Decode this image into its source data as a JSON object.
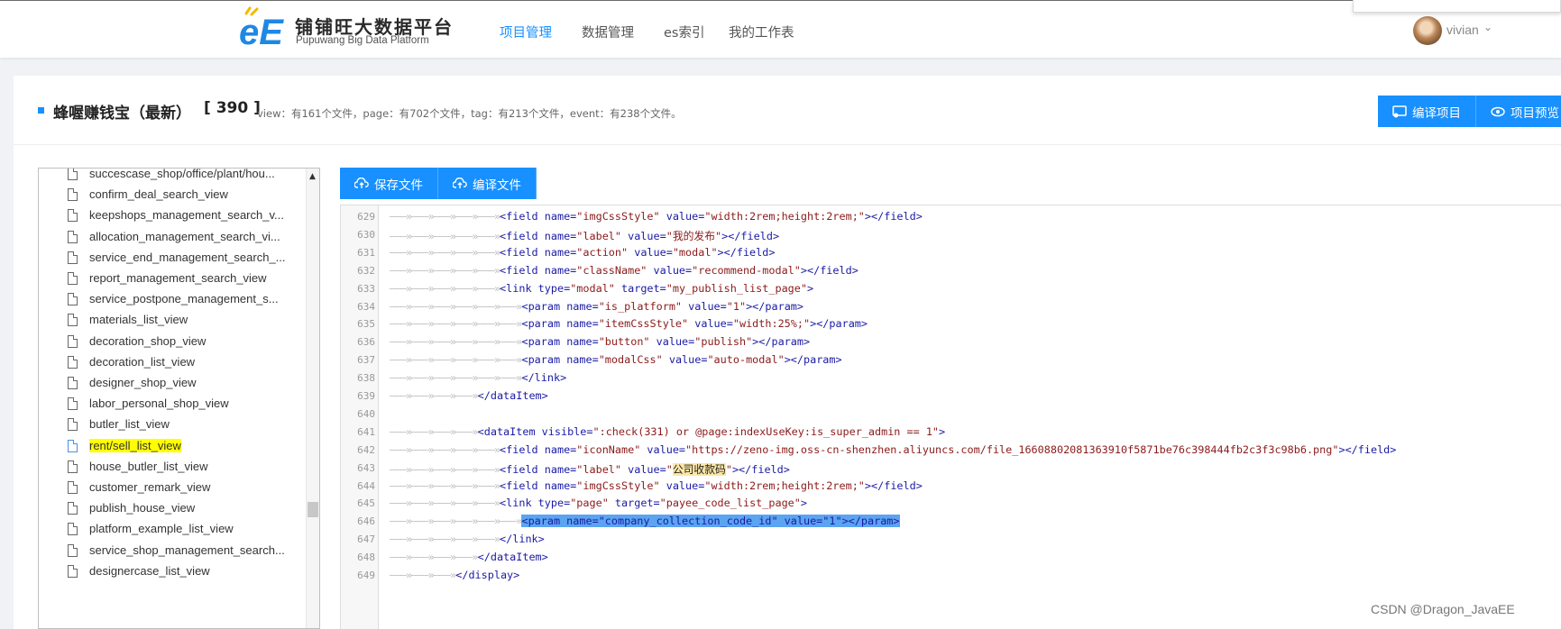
{
  "brand": {
    "title": "铺铺旺大数据平台",
    "subtitle": "Pupuwang Big Data Platform"
  },
  "nav": [
    {
      "label": "项目管理",
      "active": true
    },
    {
      "label": "数据管理",
      "active": false
    },
    {
      "label": "es索引",
      "active": false
    },
    {
      "label": "我的工作表",
      "active": false
    }
  ],
  "user": {
    "name": "vivian"
  },
  "project": {
    "title": "蜂喔赚钱宝（最新）",
    "count": "[ 390 ]",
    "stats": "view：有161个文件，page：有702个文件，tag：有213个文件，event：有238个文件。"
  },
  "actions": {
    "compile_project": "编译项目",
    "preview_project": "项目预览"
  },
  "editor_actions": {
    "save_file": "保存文件",
    "compile_file": "编译文件"
  },
  "tree": {
    "items": [
      {
        "label": "succescase_shop/office/plant/hou...",
        "selected": false
      },
      {
        "label": "confirm_deal_search_view",
        "selected": false
      },
      {
        "label": "keepshops_management_search_v...",
        "selected": false
      },
      {
        "label": "allocation_management_search_vi...",
        "selected": false
      },
      {
        "label": "service_end_management_search_...",
        "selected": false
      },
      {
        "label": "report_management_search_view",
        "selected": false
      },
      {
        "label": "service_postpone_management_s...",
        "selected": false
      },
      {
        "label": "materials_list_view",
        "selected": false
      },
      {
        "label": "decoration_shop_view",
        "selected": false
      },
      {
        "label": "decoration_list_view",
        "selected": false
      },
      {
        "label": "designer_shop_view",
        "selected": false
      },
      {
        "label": "labor_personal_shop_view",
        "selected": false
      },
      {
        "label": "butler_list_view",
        "selected": false
      },
      {
        "label": "rent/sell_list_view",
        "selected": true
      },
      {
        "label": "house_butler_list_view",
        "selected": false
      },
      {
        "label": "customer_remark_view",
        "selected": false
      },
      {
        "label": "publish_house_view",
        "selected": false
      },
      {
        "label": "platform_example_list_view",
        "selected": false
      },
      {
        "label": "service_shop_management_search...",
        "selected": false
      },
      {
        "label": "designercase_list_view",
        "selected": false
      }
    ]
  },
  "code_lines": [
    {
      "n": "629",
      "indent": 5,
      "segs": [
        [
          "tg",
          "<field "
        ],
        [
          "an",
          "name="
        ],
        [
          "av",
          "\"imgCssStyle\""
        ],
        [
          "an",
          " value="
        ],
        [
          "av",
          "\"width:2rem;height:2rem;\""
        ],
        [
          "tg",
          "></field>"
        ]
      ]
    },
    {
      "n": "630",
      "indent": 5,
      "segs": [
        [
          "tg",
          "<field "
        ],
        [
          "an",
          "name="
        ],
        [
          "av",
          "\"label\""
        ],
        [
          "an",
          " value="
        ],
        [
          "av",
          "\"我的发布\""
        ],
        [
          "tg",
          "></field>"
        ]
      ]
    },
    {
      "n": "631",
      "indent": 5,
      "segs": [
        [
          "tg",
          "<field "
        ],
        [
          "an",
          "name="
        ],
        [
          "av",
          "\"action\""
        ],
        [
          "an",
          " value="
        ],
        [
          "av",
          "\"modal\""
        ],
        [
          "tg",
          "></field>"
        ]
      ]
    },
    {
      "n": "632",
      "indent": 5,
      "segs": [
        [
          "tg",
          "<field "
        ],
        [
          "an",
          "name="
        ],
        [
          "av",
          "\"className\""
        ],
        [
          "an",
          " value="
        ],
        [
          "av",
          "\"recommend-modal\""
        ],
        [
          "tg",
          "></field>"
        ]
      ]
    },
    {
      "n": "633",
      "indent": 5,
      "segs": [
        [
          "tg",
          "<link "
        ],
        [
          "an",
          "type="
        ],
        [
          "av",
          "\"modal\""
        ],
        [
          "an",
          " target="
        ],
        [
          "av",
          "\"my_publish_list_page\""
        ],
        [
          "tg",
          ">"
        ]
      ]
    },
    {
      "n": "634",
      "indent": 6,
      "segs": [
        [
          "tg",
          "<param "
        ],
        [
          "an",
          "name="
        ],
        [
          "av",
          "\"is_platform\""
        ],
        [
          "an",
          " value="
        ],
        [
          "av",
          "\"1\""
        ],
        [
          "tg",
          "></param>"
        ]
      ]
    },
    {
      "n": "635",
      "indent": 6,
      "segs": [
        [
          "tg",
          "<param "
        ],
        [
          "an",
          "name="
        ],
        [
          "av",
          "\"itemCssStyle\""
        ],
        [
          "an",
          " value="
        ],
        [
          "av",
          "\"width:25%;\""
        ],
        [
          "tg",
          "></param>"
        ]
      ]
    },
    {
      "n": "636",
      "indent": 6,
      "segs": [
        [
          "tg",
          "<param "
        ],
        [
          "an",
          "name="
        ],
        [
          "av",
          "\"button\""
        ],
        [
          "an",
          " value="
        ],
        [
          "av",
          "\"publish\""
        ],
        [
          "tg",
          "></param>"
        ]
      ]
    },
    {
      "n": "637",
      "indent": 6,
      "segs": [
        [
          "tg",
          "<param "
        ],
        [
          "an",
          "name="
        ],
        [
          "av",
          "\"modalCss\""
        ],
        [
          "an",
          " value="
        ],
        [
          "av",
          "\"auto-modal\""
        ],
        [
          "tg",
          "></param>"
        ]
      ]
    },
    {
      "n": "638",
      "indent": 6,
      "segs": [
        [
          "tg",
          "</link>"
        ]
      ]
    },
    {
      "n": "639",
      "indent": 4,
      "segs": [
        [
          "tg",
          "</dataItem>"
        ]
      ]
    },
    {
      "n": "640",
      "indent": 0,
      "segs": []
    },
    {
      "n": "641",
      "indent": 4,
      "segs": [
        [
          "tg",
          "<dataItem "
        ],
        [
          "an",
          "visible="
        ],
        [
          "av",
          "\":check(331) or @page:indexUseKey:is_super_admin == 1\""
        ],
        [
          "tg",
          ">"
        ]
      ]
    },
    {
      "n": "642",
      "indent": 5,
      "segs": [
        [
          "tg",
          "<field "
        ],
        [
          "an",
          "name="
        ],
        [
          "av",
          "\"iconName\""
        ],
        [
          "an",
          " value="
        ],
        [
          "av",
          "\"https://zeno-img.oss-cn-shenzhen.aliyuncs.com/file_16608802081363910f5871be76c398444fb2c3f3c98b6.png\""
        ],
        [
          "tg",
          "></field>"
        ]
      ]
    },
    {
      "n": "643",
      "indent": 5,
      "segs": [
        [
          "tg",
          "<field "
        ],
        [
          "an",
          "name="
        ],
        [
          "av",
          "\""
        ],
        [
          "yel",
          "公司收款码"
        ],
        [
          "av",
          "\""
        ],
        [
          "tg",
          "></field>"
        ]
      ],
      "prefix": [
        [
          "an",
          "name="
        ],
        [
          "av",
          "\"label\""
        ],
        [
          "an",
          " value="
        ]
      ]
    },
    {
      "n": "644",
      "indent": 5,
      "segs": [
        [
          "tg",
          "<field "
        ],
        [
          "an",
          "name="
        ],
        [
          "av",
          "\"imgCssStyle\""
        ],
        [
          "an",
          " value="
        ],
        [
          "av",
          "\"width:2rem;height:2rem;\""
        ],
        [
          "tg",
          "></field>"
        ]
      ]
    },
    {
      "n": "645",
      "indent": 5,
      "segs": [
        [
          "tg",
          "<link "
        ],
        [
          "an",
          "type="
        ],
        [
          "av",
          "\"page\""
        ],
        [
          "an",
          " target="
        ],
        [
          "av",
          "\"payee_code_list_page\""
        ],
        [
          "tg",
          ">"
        ]
      ]
    },
    {
      "n": "646",
      "indent": 6,
      "segs": [
        [
          "hl",
          "<param name=\"company_collection_code_id\" value=\"1\"></param>"
        ]
      ]
    },
    {
      "n": "647",
      "indent": 5,
      "segs": [
        [
          "tg",
          "</link>"
        ]
      ]
    },
    {
      "n": "648",
      "indent": 4,
      "segs": [
        [
          "tg",
          "</dataItem>"
        ]
      ]
    },
    {
      "n": "649",
      "indent": 3,
      "segs": [
        [
          "tg",
          "</display>"
        ]
      ]
    }
  ],
  "watermark": "CSDN @Dragon_JavaEE"
}
